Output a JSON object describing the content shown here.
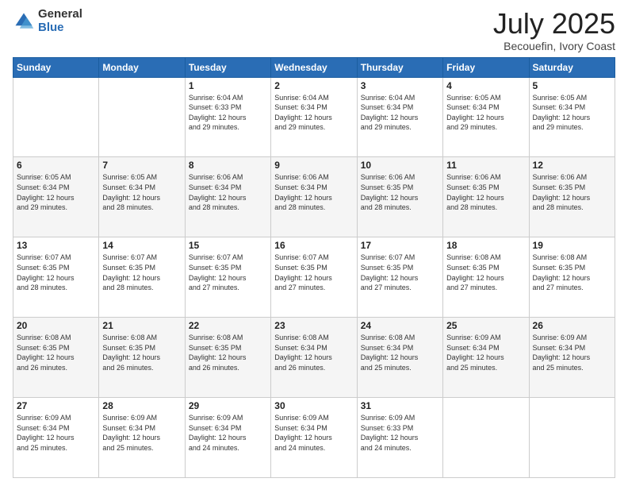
{
  "logo": {
    "general": "General",
    "blue": "Blue"
  },
  "title": "July 2025",
  "subtitle": "Becouefin, Ivory Coast",
  "days_header": [
    "Sunday",
    "Monday",
    "Tuesday",
    "Wednesday",
    "Thursday",
    "Friday",
    "Saturday"
  ],
  "weeks": [
    [
      {
        "num": "",
        "info": ""
      },
      {
        "num": "",
        "info": ""
      },
      {
        "num": "1",
        "info": "Sunrise: 6:04 AM\nSunset: 6:33 PM\nDaylight: 12 hours\nand 29 minutes."
      },
      {
        "num": "2",
        "info": "Sunrise: 6:04 AM\nSunset: 6:34 PM\nDaylight: 12 hours\nand 29 minutes."
      },
      {
        "num": "3",
        "info": "Sunrise: 6:04 AM\nSunset: 6:34 PM\nDaylight: 12 hours\nand 29 minutes."
      },
      {
        "num": "4",
        "info": "Sunrise: 6:05 AM\nSunset: 6:34 PM\nDaylight: 12 hours\nand 29 minutes."
      },
      {
        "num": "5",
        "info": "Sunrise: 6:05 AM\nSunset: 6:34 PM\nDaylight: 12 hours\nand 29 minutes."
      }
    ],
    [
      {
        "num": "6",
        "info": "Sunrise: 6:05 AM\nSunset: 6:34 PM\nDaylight: 12 hours\nand 29 minutes."
      },
      {
        "num": "7",
        "info": "Sunrise: 6:05 AM\nSunset: 6:34 PM\nDaylight: 12 hours\nand 28 minutes."
      },
      {
        "num": "8",
        "info": "Sunrise: 6:06 AM\nSunset: 6:34 PM\nDaylight: 12 hours\nand 28 minutes."
      },
      {
        "num": "9",
        "info": "Sunrise: 6:06 AM\nSunset: 6:34 PM\nDaylight: 12 hours\nand 28 minutes."
      },
      {
        "num": "10",
        "info": "Sunrise: 6:06 AM\nSunset: 6:35 PM\nDaylight: 12 hours\nand 28 minutes."
      },
      {
        "num": "11",
        "info": "Sunrise: 6:06 AM\nSunset: 6:35 PM\nDaylight: 12 hours\nand 28 minutes."
      },
      {
        "num": "12",
        "info": "Sunrise: 6:06 AM\nSunset: 6:35 PM\nDaylight: 12 hours\nand 28 minutes."
      }
    ],
    [
      {
        "num": "13",
        "info": "Sunrise: 6:07 AM\nSunset: 6:35 PM\nDaylight: 12 hours\nand 28 minutes."
      },
      {
        "num": "14",
        "info": "Sunrise: 6:07 AM\nSunset: 6:35 PM\nDaylight: 12 hours\nand 28 minutes."
      },
      {
        "num": "15",
        "info": "Sunrise: 6:07 AM\nSunset: 6:35 PM\nDaylight: 12 hours\nand 27 minutes."
      },
      {
        "num": "16",
        "info": "Sunrise: 6:07 AM\nSunset: 6:35 PM\nDaylight: 12 hours\nand 27 minutes."
      },
      {
        "num": "17",
        "info": "Sunrise: 6:07 AM\nSunset: 6:35 PM\nDaylight: 12 hours\nand 27 minutes."
      },
      {
        "num": "18",
        "info": "Sunrise: 6:08 AM\nSunset: 6:35 PM\nDaylight: 12 hours\nand 27 minutes."
      },
      {
        "num": "19",
        "info": "Sunrise: 6:08 AM\nSunset: 6:35 PM\nDaylight: 12 hours\nand 27 minutes."
      }
    ],
    [
      {
        "num": "20",
        "info": "Sunrise: 6:08 AM\nSunset: 6:35 PM\nDaylight: 12 hours\nand 26 minutes."
      },
      {
        "num": "21",
        "info": "Sunrise: 6:08 AM\nSunset: 6:35 PM\nDaylight: 12 hours\nand 26 minutes."
      },
      {
        "num": "22",
        "info": "Sunrise: 6:08 AM\nSunset: 6:35 PM\nDaylight: 12 hours\nand 26 minutes."
      },
      {
        "num": "23",
        "info": "Sunrise: 6:08 AM\nSunset: 6:34 PM\nDaylight: 12 hours\nand 26 minutes."
      },
      {
        "num": "24",
        "info": "Sunrise: 6:08 AM\nSunset: 6:34 PM\nDaylight: 12 hours\nand 25 minutes."
      },
      {
        "num": "25",
        "info": "Sunrise: 6:09 AM\nSunset: 6:34 PM\nDaylight: 12 hours\nand 25 minutes."
      },
      {
        "num": "26",
        "info": "Sunrise: 6:09 AM\nSunset: 6:34 PM\nDaylight: 12 hours\nand 25 minutes."
      }
    ],
    [
      {
        "num": "27",
        "info": "Sunrise: 6:09 AM\nSunset: 6:34 PM\nDaylight: 12 hours\nand 25 minutes."
      },
      {
        "num": "28",
        "info": "Sunrise: 6:09 AM\nSunset: 6:34 PM\nDaylight: 12 hours\nand 25 minutes."
      },
      {
        "num": "29",
        "info": "Sunrise: 6:09 AM\nSunset: 6:34 PM\nDaylight: 12 hours\nand 24 minutes."
      },
      {
        "num": "30",
        "info": "Sunrise: 6:09 AM\nSunset: 6:34 PM\nDaylight: 12 hours\nand 24 minutes."
      },
      {
        "num": "31",
        "info": "Sunrise: 6:09 AM\nSunset: 6:33 PM\nDaylight: 12 hours\nand 24 minutes."
      },
      {
        "num": "",
        "info": ""
      },
      {
        "num": "",
        "info": ""
      }
    ]
  ]
}
